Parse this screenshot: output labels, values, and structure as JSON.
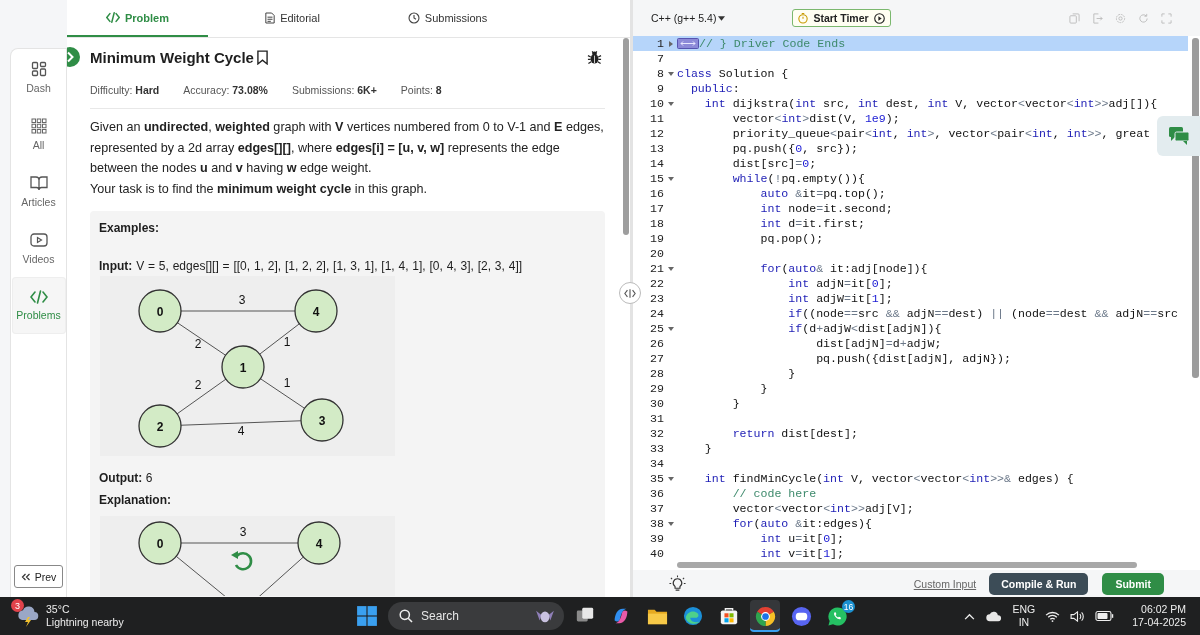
{
  "problem_tabs": [
    {
      "label": "Problem",
      "selected": true
    },
    {
      "label": "Editorial",
      "selected": false
    },
    {
      "label": "Submissions",
      "selected": false
    }
  ],
  "sidebar": {
    "items": [
      {
        "label": "Dash",
        "selected": false
      },
      {
        "label": "All",
        "selected": false
      },
      {
        "label": "Articles",
        "selected": false
      },
      {
        "label": "Videos",
        "selected": false
      },
      {
        "label": "Problems",
        "selected": true
      }
    ],
    "prev_button": "Prev"
  },
  "problem": {
    "title": "Minimum Weight Cycle",
    "meta": [
      "Difficulty: **Hard**",
      "Accuracy: **73.08%**",
      "Submissions: **6K+**",
      "Points: **8**"
    ],
    "description": [
      "Given an **undirected**, **weighted** graph with **V** vertices numbered from 0 to V-1 and **E** edges, represented by a 2d array **edges[][]**, where **edges[i] = [u, v, w]** represents the edge between the nodes **u** and **v** having **w** edge weight.",
      "Your task is to find the **minimum weight cycle** in this graph."
    ],
    "examples_heading": "Examples:",
    "input": "**Input:** V = 5, edges[][] = [[0, 1, 2], [1, 2, 2], [1, 3, 1], [1, 4, 1], [0, 4, 3], [2, 3, 4]]",
    "example_graph": {
      "nodes": [
        {
          "label": "0"
        },
        {
          "label": "4"
        },
        {
          "label": "1"
        },
        {
          "label": "2"
        },
        {
          "label": "3"
        }
      ],
      "edges": [
        {
          "kind": "full",
          "weight": "3"
        },
        {
          "kind": "full",
          "weight": "2"
        },
        {
          "kind": "full",
          "weight": "1"
        },
        {
          "kind": "full",
          "weight": "2"
        },
        {
          "kind": "full",
          "weight": "1"
        },
        {
          "kind": "full",
          "weight": "4"
        }
      ]
    },
    "output": "**Output:** 6",
    "explanation_heading": "Explanation:",
    "explanation_graph": {
      "nodes": [
        {
          "label": "0"
        },
        {
          "label": "4"
        }
      ],
      "edges": [
        {
          "kind": "full",
          "weight": "3"
        },
        {
          "kind": "cut"
        },
        {
          "kind": "cut"
        }
      ]
    }
  },
  "editor": {
    "language": "C++ (g++ 5.4)",
    "timer_button": "Start Timer",
    "lines": [
      {
        "number": "1",
        "kind": "folded",
        "active": true,
        "tokens": [
          {
            "kind": "comment",
            "text": "// } Driver Code Ends"
          }
        ]
      },
      {
        "number": "7",
        "kind": "plain",
        "active": false
      },
      {
        "number": "8",
        "kind": "foldable",
        "active": false,
        "tokens": [
          {
            "kind": "keyword",
            "text": "class"
          },
          {
            "kind": "text",
            "text": " Solution {"
          }
        ]
      },
      {
        "number": "9",
        "kind": "plain",
        "active": false,
        "tokens": [
          {
            "kind": "keyword",
            "text": "  public"
          },
          {
            "kind": "text",
            "text": ":"
          }
        ]
      },
      {
        "number": "10",
        "kind": "foldable",
        "active": false,
        "tokens": [
          {
            "kind": "keyword",
            "text": "    int"
          },
          {
            "kind": "text",
            "text": " dijkstra("
          },
          {
            "kind": "keyword",
            "text": "int"
          },
          {
            "kind": "text",
            "text": " src, "
          },
          {
            "kind": "keyword",
            "text": "int"
          },
          {
            "kind": "text",
            "text": " dest, "
          },
          {
            "kind": "keyword",
            "text": "int"
          },
          {
            "kind": "text",
            "text": " V, vector"
          },
          {
            "kind": "operator",
            "text": "<"
          },
          {
            "kind": "text",
            "text": "vector"
          },
          {
            "kind": "operator",
            "text": "<"
          },
          {
            "kind": "keyword",
            "text": "int"
          },
          {
            "kind": "operator",
            "text": ">>"
          },
          {
            "kind": "text",
            "text": "adj[]){"
          }
        ]
      },
      {
        "number": "11",
        "kind": "plain",
        "active": false,
        "tokens": [
          {
            "kind": "text",
            "text": "        vector"
          },
          {
            "kind": "operator",
            "text": "<"
          },
          {
            "kind": "keyword",
            "text": "int"
          },
          {
            "kind": "operator",
            "text": ">"
          },
          {
            "kind": "text",
            "text": "dist(V, "
          },
          {
            "kind": "number",
            "text": "1e9"
          },
          {
            "kind": "text",
            "text": ");"
          }
        ]
      },
      {
        "number": "12",
        "kind": "plain",
        "active": false,
        "tokens": [
          {
            "kind": "text",
            "text": "        priority_queue"
          },
          {
            "kind": "operator",
            "text": "<"
          },
          {
            "kind": "text",
            "text": "pair"
          },
          {
            "kind": "operator",
            "text": "<"
          },
          {
            "kind": "keyword",
            "text": "int"
          },
          {
            "kind": "text",
            "text": ", "
          },
          {
            "kind": "keyword",
            "text": "int"
          },
          {
            "kind": "operator",
            "text": ">"
          },
          {
            "kind": "text",
            "text": ", vector"
          },
          {
            "kind": "operator",
            "text": "<"
          },
          {
            "kind": "text",
            "text": "pair"
          },
          {
            "kind": "operator",
            "text": "<"
          },
          {
            "kind": "keyword",
            "text": "int"
          },
          {
            "kind": "text",
            "text": ", "
          },
          {
            "kind": "keyword",
            "text": "int"
          },
          {
            "kind": "operator",
            "text": ">>"
          },
          {
            "kind": "text",
            "text": ", great"
          }
        ]
      },
      {
        "number": "13",
        "kind": "plain",
        "active": false,
        "tokens": [
          {
            "kind": "text",
            "text": "        pq.push({"
          },
          {
            "kind": "number",
            "text": "0"
          },
          {
            "kind": "text",
            "text": ", src});"
          }
        ]
      },
      {
        "number": "14",
        "kind": "plain",
        "active": false,
        "tokens": [
          {
            "kind": "text",
            "text": "        dist[src]"
          },
          {
            "kind": "operator",
            "text": "="
          },
          {
            "kind": "number",
            "text": "0"
          },
          {
            "kind": "text",
            "text": ";"
          }
        ]
      },
      {
        "number": "15",
        "kind": "foldable",
        "active": false,
        "tokens": [
          {
            "kind": "keyword",
            "text": "        while"
          },
          {
            "kind": "text",
            "text": "("
          },
          {
            "kind": "operator",
            "text": "!"
          },
          {
            "kind": "text",
            "text": "pq.empty()){"
          }
        ]
      },
      {
        "number": "16",
        "kind": "plain",
        "active": false,
        "tokens": [
          {
            "kind": "keyword",
            "text": "            auto"
          },
          {
            "kind": "operator",
            "text": " &"
          },
          {
            "kind": "text",
            "text": "it"
          },
          {
            "kind": "operator",
            "text": "="
          },
          {
            "kind": "text",
            "text": "pq.top();"
          }
        ]
      },
      {
        "number": "17",
        "kind": "plain",
        "active": false,
        "tokens": [
          {
            "kind": "keyword",
            "text": "            int"
          },
          {
            "kind": "text",
            "text": " node"
          },
          {
            "kind": "operator",
            "text": "="
          },
          {
            "kind": "text",
            "text": "it.second;"
          }
        ]
      },
      {
        "number": "18",
        "kind": "plain",
        "active": false,
        "tokens": [
          {
            "kind": "keyword",
            "text": "            int"
          },
          {
            "kind": "text",
            "text": " d"
          },
          {
            "kind": "operator",
            "text": "="
          },
          {
            "kind": "text",
            "text": "it.first;"
          }
        ]
      },
      {
        "number": "19",
        "kind": "plain",
        "active": false,
        "tokens": [
          {
            "kind": "text",
            "text": "            pq.pop();"
          }
        ]
      },
      {
        "number": "20",
        "kind": "plain",
        "active": false
      },
      {
        "number": "21",
        "kind": "foldable",
        "active": false,
        "tokens": [
          {
            "kind": "keyword",
            "text": "            for"
          },
          {
            "kind": "text",
            "text": "("
          },
          {
            "kind": "keyword",
            "text": "auto"
          },
          {
            "kind": "operator",
            "text": "&"
          },
          {
            "kind": "text",
            "text": " it:adj[node]){"
          }
        ]
      },
      {
        "number": "22",
        "kind": "plain",
        "active": false,
        "tokens": [
          {
            "kind": "keyword",
            "text": "                int"
          },
          {
            "kind": "text",
            "text": " adjN"
          },
          {
            "kind": "operator",
            "text": "="
          },
          {
            "kind": "text",
            "text": "it["
          },
          {
            "kind": "number",
            "text": "0"
          },
          {
            "kind": "text",
            "text": "];"
          }
        ]
      },
      {
        "number": "23",
        "kind": "plain",
        "active": false,
        "tokens": [
          {
            "kind": "keyword",
            "text": "                int"
          },
          {
            "kind": "text",
            "text": " adjW"
          },
          {
            "kind": "operator",
            "text": "="
          },
          {
            "kind": "text",
            "text": "it["
          },
          {
            "kind": "number",
            "text": "1"
          },
          {
            "kind": "text",
            "text": "];"
          }
        ]
      },
      {
        "number": "24",
        "kind": "plain",
        "active": false,
        "tokens": [
          {
            "kind": "keyword",
            "text": "                if"
          },
          {
            "kind": "text",
            "text": "((node"
          },
          {
            "kind": "operator",
            "text": "=="
          },
          {
            "kind": "text",
            "text": "src "
          },
          {
            "kind": "operator",
            "text": "&&"
          },
          {
            "kind": "text",
            "text": " adjN"
          },
          {
            "kind": "operator",
            "text": "=="
          },
          {
            "kind": "text",
            "text": "dest) "
          },
          {
            "kind": "operator",
            "text": "||"
          },
          {
            "kind": "text",
            "text": " (node"
          },
          {
            "kind": "operator",
            "text": "=="
          },
          {
            "kind": "text",
            "text": "dest "
          },
          {
            "kind": "operator",
            "text": "&&"
          },
          {
            "kind": "text",
            "text": " adjN"
          },
          {
            "kind": "operator",
            "text": "=="
          },
          {
            "kind": "text",
            "text": "src"
          }
        ]
      },
      {
        "number": "25",
        "kind": "foldable",
        "active": false,
        "tokens": [
          {
            "kind": "keyword",
            "text": "                if"
          },
          {
            "kind": "text",
            "text": "(d"
          },
          {
            "kind": "operator",
            "text": "+"
          },
          {
            "kind": "text",
            "text": "adjW"
          },
          {
            "kind": "operator",
            "text": "<"
          },
          {
            "kind": "text",
            "text": "dist[adjN]){"
          }
        ]
      },
      {
        "number": "26",
        "kind": "plain",
        "active": false,
        "tokens": [
          {
            "kind": "text",
            "text": "                    dist[adjN]"
          },
          {
            "kind": "operator",
            "text": "="
          },
          {
            "kind": "text",
            "text": "d"
          },
          {
            "kind": "operator",
            "text": "+"
          },
          {
            "kind": "text",
            "text": "adjW;"
          }
        ]
      },
      {
        "number": "27",
        "kind": "plain",
        "active": false,
        "tokens": [
          {
            "kind": "text",
            "text": "                    pq.push({dist[adjN], adjN});"
          }
        ]
      },
      {
        "number": "28",
        "kind": "plain",
        "active": false,
        "tokens": [
          {
            "kind": "text",
            "text": "                }"
          }
        ]
      },
      {
        "number": "29",
        "kind": "plain",
        "active": false,
        "tokens": [
          {
            "kind": "text",
            "text": "            }"
          }
        ]
      },
      {
        "number": "30",
        "kind": "plain",
        "active": false,
        "tokens": [
          {
            "kind": "text",
            "text": "        }"
          }
        ]
      },
      {
        "number": "31",
        "kind": "plain",
        "active": false
      },
      {
        "number": "32",
        "kind": "plain",
        "active": false,
        "tokens": [
          {
            "kind": "keyword",
            "text": "        return"
          },
          {
            "kind": "text",
            "text": " dist[dest];"
          }
        ]
      },
      {
        "number": "33",
        "kind": "plain",
        "active": false,
        "tokens": [
          {
            "kind": "text",
            "text": "    }"
          }
        ]
      },
      {
        "number": "34",
        "kind": "plain",
        "active": false
      },
      {
        "number": "35",
        "kind": "foldable",
        "active": false,
        "tokens": [
          {
            "kind": "keyword",
            "text": "    int"
          },
          {
            "kind": "text",
            "text": " findMinCycle("
          },
          {
            "kind": "keyword",
            "text": "int"
          },
          {
            "kind": "text",
            "text": " V, vector"
          },
          {
            "kind": "operator",
            "text": "<"
          },
          {
            "kind": "text",
            "text": "vector"
          },
          {
            "kind": "operator",
            "text": "<"
          },
          {
            "kind": "keyword",
            "text": "int"
          },
          {
            "kind": "operator",
            "text": ">>&"
          },
          {
            "kind": "text",
            "text": " edges) {"
          }
        ]
      },
      {
        "number": "36",
        "kind": "plain",
        "active": false,
        "tokens": [
          {
            "kind": "comment",
            "text": "        // code here"
          }
        ]
      },
      {
        "number": "37",
        "kind": "plain",
        "active": false,
        "tokens": [
          {
            "kind": "text",
            "text": "        vector"
          },
          {
            "kind": "operator",
            "text": "<"
          },
          {
            "kind": "text",
            "text": "vector"
          },
          {
            "kind": "operator",
            "text": "<"
          },
          {
            "kind": "keyword",
            "text": "int"
          },
          {
            "kind": "operator",
            "text": ">>"
          },
          {
            "kind": "text",
            "text": "adj[V];"
          }
        ]
      },
      {
        "number": "38",
        "kind": "foldable",
        "active": false,
        "tokens": [
          {
            "kind": "keyword",
            "text": "        for"
          },
          {
            "kind": "text",
            "text": "("
          },
          {
            "kind": "keyword",
            "text": "auto"
          },
          {
            "kind": "operator",
            "text": " &"
          },
          {
            "kind": "text",
            "text": "it:edges){"
          }
        ]
      },
      {
        "number": "39",
        "kind": "plain",
        "active": false,
        "tokens": [
          {
            "kind": "keyword",
            "text": "            int"
          },
          {
            "kind": "text",
            "text": " u"
          },
          {
            "kind": "operator",
            "text": "="
          },
          {
            "kind": "text",
            "text": "it["
          },
          {
            "kind": "number",
            "text": "0"
          },
          {
            "kind": "text",
            "text": "];"
          }
        ]
      },
      {
        "number": "40",
        "kind": "plain",
        "active": false,
        "tokens": [
          {
            "kind": "keyword",
            "text": "            int"
          },
          {
            "kind": "text",
            "text": " v"
          },
          {
            "kind": "operator",
            "text": "="
          },
          {
            "kind": "text",
            "text": "it["
          },
          {
            "kind": "number",
            "text": "1"
          },
          {
            "kind": "text",
            "text": "];"
          }
        ]
      }
    ],
    "custom_input": "Custom Input",
    "compile_button": "Compile & Run",
    "submit_button": "Submit"
  },
  "taskbar": {
    "weather": {
      "alerts": "3",
      "temperature": "35°C",
      "condition": "Lightning nearby"
    },
    "search": {
      "placeholder": "Search"
    },
    "apps": [
      {
        "kind": "stack",
        "active": false
      },
      {
        "kind": "assistant",
        "active": false
      },
      {
        "kind": "folder",
        "active": false
      },
      {
        "kind": "wave",
        "active": false
      },
      {
        "kind": "store",
        "active": false
      },
      {
        "kind": "wheel",
        "active": true
      },
      {
        "kind": "gamepad",
        "active": false
      },
      {
        "kind": "phone",
        "active": false,
        "badge": "16"
      }
    ],
    "tray": {
      "language": "ENG",
      "region": "IN",
      "time": "06:02 PM",
      "date": "17-04-2025"
    }
  }
}
